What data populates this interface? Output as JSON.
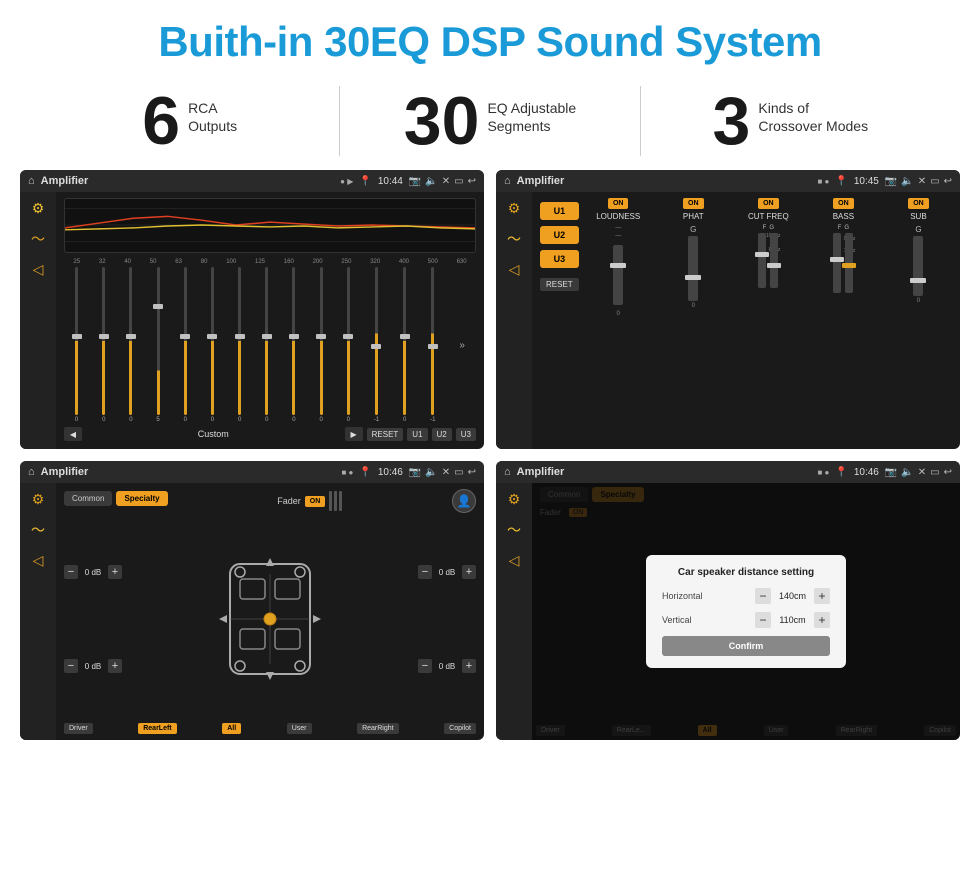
{
  "header": {
    "title": "Buith-in 30EQ DSP Sound System"
  },
  "stats": [
    {
      "number": "6",
      "text_line1": "RCA",
      "text_line2": "Outputs"
    },
    {
      "number": "30",
      "text_line1": "EQ Adjustable",
      "text_line2": "Segments"
    },
    {
      "number": "3",
      "text_line1": "Kinds of",
      "text_line2": "Crossover Modes"
    }
  ],
  "screens": {
    "screen1": {
      "topbar": {
        "title": "Amplifier",
        "time": "10:44"
      },
      "preset": "Custom",
      "freqs": [
        "25",
        "32",
        "40",
        "50",
        "63",
        "80",
        "100",
        "125",
        "160",
        "200",
        "250",
        "320",
        "400",
        "500",
        "630"
      ],
      "values": [
        "0",
        "0",
        "0",
        "5",
        "0",
        "0",
        "0",
        "0",
        "0",
        "0",
        "0",
        "-1",
        "0",
        "-1"
      ],
      "buttons": [
        "RESET",
        "U1",
        "U2",
        "U3"
      ]
    },
    "screen2": {
      "topbar": {
        "title": "Amplifier",
        "time": "10:45"
      },
      "presets": [
        "U1",
        "U2",
        "U3"
      ],
      "channels": [
        "LOUDNESS",
        "PHAT",
        "CUT FREQ",
        "BASS",
        "SUB"
      ],
      "toggles": [
        "ON",
        "ON",
        "ON",
        "ON",
        "ON"
      ],
      "reset_label": "RESET"
    },
    "screen3": {
      "topbar": {
        "title": "Amplifier",
        "time": "10:46"
      },
      "tabs": [
        "Common",
        "Specialty"
      ],
      "fader_label": "Fader",
      "fader_toggle": "ON",
      "db_values": [
        "0 dB",
        "0 dB",
        "0 dB",
        "0 dB"
      ],
      "buttons": [
        "Driver",
        "RearLeft",
        "All",
        "User",
        "RearRight",
        "Copilot"
      ]
    },
    "screen4": {
      "topbar": {
        "title": "Amplifier",
        "time": "10:46"
      },
      "tabs": [
        "Common",
        "Specialty"
      ],
      "dialog": {
        "title": "Car speaker distance setting",
        "horizontal_label": "Horizontal",
        "horizontal_value": "140cm",
        "vertical_label": "Vertical",
        "vertical_value": "110cm",
        "confirm_label": "Confirm"
      },
      "buttons": [
        "Driver",
        "RearLeft",
        "All",
        "User",
        "RearRight",
        "Copilot"
      ]
    }
  }
}
